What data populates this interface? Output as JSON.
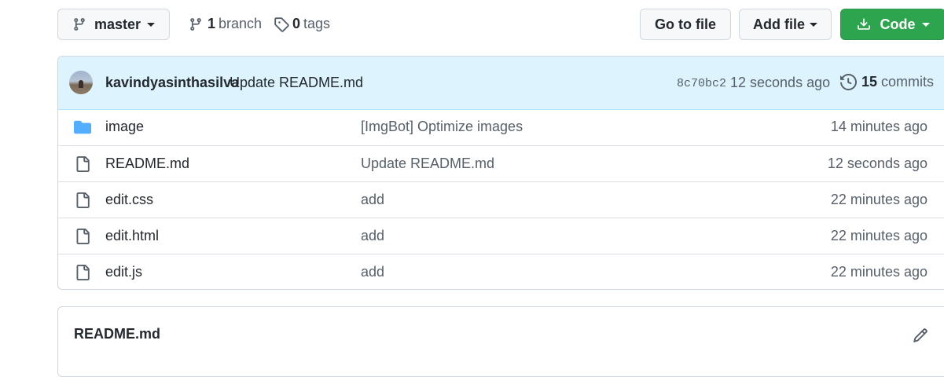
{
  "toolbar": {
    "branch_select": "master",
    "branches_count": "1",
    "branches_label": "branch",
    "tags_count": "0",
    "tags_label": "tags",
    "go_to_file": "Go to file",
    "add_file": "Add file",
    "code": "Code"
  },
  "latest_commit": {
    "author": "kavindyasinthasilva",
    "message": "Update README.md",
    "sha": "8c70bc2",
    "time": "12 seconds ago",
    "commits_count": "15",
    "commits_label": "commits"
  },
  "files": [
    {
      "name": "image",
      "type": "folder",
      "message": "[ImgBot] Optimize images",
      "age": "14 minutes ago"
    },
    {
      "name": "README.md",
      "type": "file",
      "message": "Update README.md",
      "age": "12 seconds ago"
    },
    {
      "name": "edit.css",
      "type": "file",
      "message": "add",
      "age": "22 minutes ago"
    },
    {
      "name": "edit.html",
      "type": "file",
      "message": "add",
      "age": "22 minutes ago"
    },
    {
      "name": "edit.js",
      "type": "file",
      "message": "add",
      "age": "22 minutes ago"
    }
  ],
  "readme": {
    "title": "README.md"
  },
  "colors": {
    "code_button": "#2da44e",
    "folder_icon": "#54aeff",
    "commit_bar": "#ddf4ff"
  },
  "icons": {
    "branch": "git-branch-icon",
    "tag": "tag-icon",
    "history": "history-icon",
    "download": "download-icon",
    "folder": "folder-icon",
    "file": "file-icon",
    "edit": "pencil-icon"
  }
}
